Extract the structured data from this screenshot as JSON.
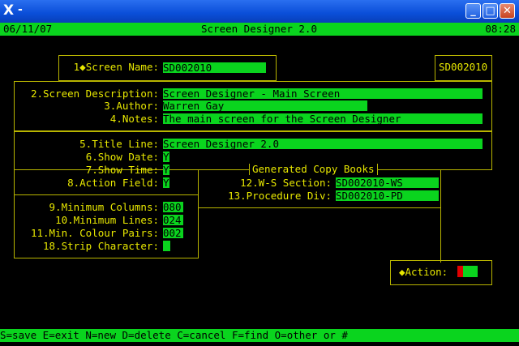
{
  "window": {
    "title_glyph": "X",
    "title_dash": "-",
    "minimize": "_",
    "maximize": "□",
    "close": "✕"
  },
  "header": {
    "date": "06/11/07",
    "title": "Screen Designer 2.0",
    "time": "08:28"
  },
  "screen_name": {
    "label": "1◆Screen Name:",
    "value": "SD002010"
  },
  "side_id": "SD002010",
  "descr": {
    "description_label": "2.Screen Description:",
    "description_value": "Screen Designer - Main Screen",
    "author_label": "3.Author:",
    "author_value": "Warren Gay",
    "notes_label": "4.Notes:",
    "notes_value": "The main screen for the Screen Designer"
  },
  "options": {
    "title_line_label": "5.Title Line:",
    "title_line_value": "Screen Designer 2.0",
    "show_date_label": "6.Show Date:",
    "show_date_value": "Y",
    "show_time_label": "7.Show Time:",
    "show_time_value": "Y",
    "action_field_label": "8.Action Field:",
    "action_field_value": "Y"
  },
  "copybooks": {
    "title": "Generated Copy Books",
    "ws_label": "12.W-S Section:",
    "ws_value": "SD002010-WS",
    "pd_label": "13.Procedure Div:",
    "pd_value": "SD002010-PD"
  },
  "limits": {
    "min_cols_label": "9.Minimum Columns:",
    "min_cols_value": "080",
    "min_lines_label": "10.Minimum Lines:",
    "min_lines_value": "024",
    "colour_pairs_label": "11.Min. Colour Pairs:",
    "colour_pairs_value": "002",
    "strip_label": "18.Strip Character:",
    "strip_value": "_"
  },
  "action": {
    "label": "◆Action:"
  },
  "footer": "S=save E=exit N=new D=delete C=cancel F=find O=other or #"
}
